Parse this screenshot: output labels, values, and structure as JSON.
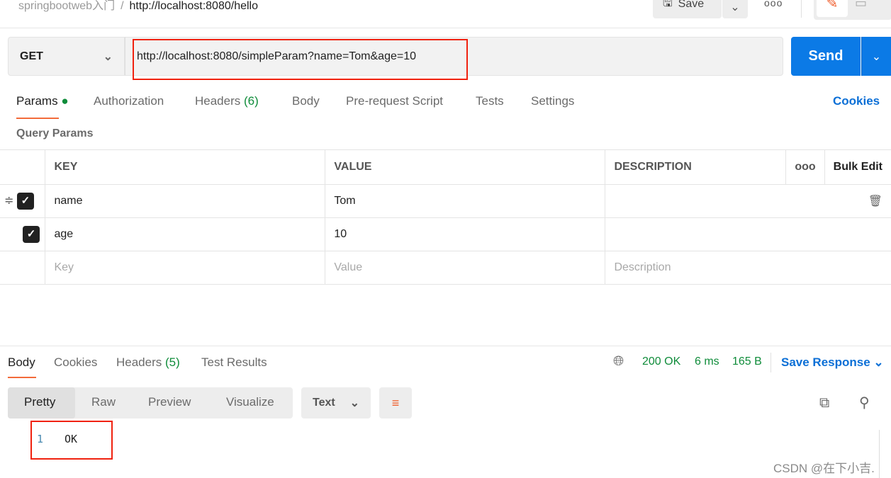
{
  "header": {
    "collection": "springbootweb入门",
    "separator": "/",
    "request_name": "http://localhost:8080/hello",
    "save_label": "Save",
    "more": "ooo"
  },
  "request": {
    "method": "GET",
    "url": "http://localhost:8080/simpleParam?name=Tom&age=10",
    "send_label": "Send"
  },
  "tabs": [
    {
      "label": "Params"
    },
    {
      "label": "Authorization"
    },
    {
      "label": "Headers",
      "count": "(6)"
    },
    {
      "label": "Body"
    },
    {
      "label": "Pre-request Script"
    },
    {
      "label": "Tests"
    },
    {
      "label": "Settings"
    }
  ],
  "cookies_link": "Cookies",
  "query_params": {
    "title": "Query Params",
    "columns": [
      "KEY",
      "VALUE",
      "DESCRIPTION"
    ],
    "more": "ooo",
    "bulk_edit": "Bulk Edit",
    "rows": [
      {
        "key": "name",
        "value": "Tom",
        "description": "",
        "checked": true
      },
      {
        "key": "age",
        "value": "10",
        "description": "",
        "checked": true
      }
    ],
    "placeholders": {
      "key": "Key",
      "value": "Value",
      "description": "Description"
    }
  },
  "response": {
    "tabs": [
      {
        "label": "Body"
      },
      {
        "label": "Cookies"
      },
      {
        "label": "Headers",
        "count": "(5)"
      },
      {
        "label": "Test Results"
      }
    ],
    "status": "200 OK",
    "time": "6 ms",
    "size": "165 B",
    "save_response": "Save Response",
    "formats": [
      "Pretty",
      "Raw",
      "Preview",
      "Visualize"
    ],
    "type": "Text",
    "lines": [
      {
        "num": "1",
        "text": "OK"
      }
    ]
  },
  "watermark": "CSDN @在下小吉.",
  "colors": {
    "accent": "#f26b3a",
    "send": "#0b7ae6",
    "highlight": "#f0220f",
    "status_ok": "#0f8c3a"
  }
}
